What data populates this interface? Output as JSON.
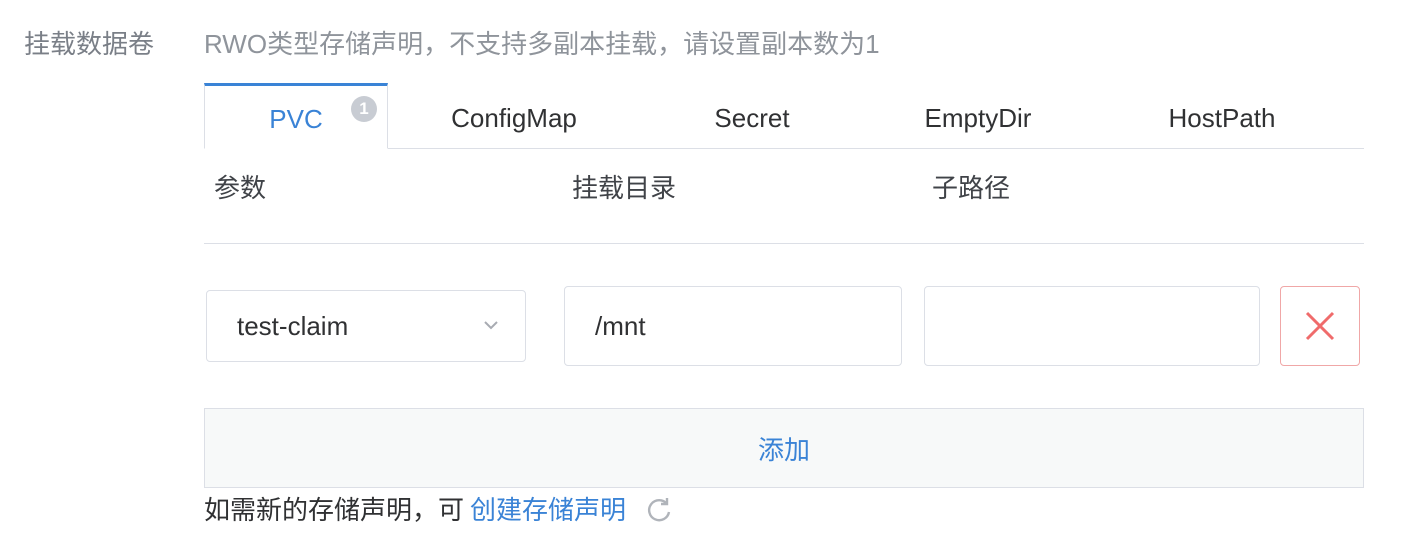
{
  "form": {
    "label": "挂载数据卷",
    "hint": "RWO类型存储声明，不支持多副本挂载，请设置副本数为1"
  },
  "tabs": [
    {
      "label": "PVC",
      "badge": "1",
      "active": true
    },
    {
      "label": "ConfigMap"
    },
    {
      "label": "Secret"
    },
    {
      "label": "EmptyDir"
    },
    {
      "label": "HostPath"
    }
  ],
  "table": {
    "headers": [
      "参数",
      "挂载目录",
      "子路径"
    ],
    "row": {
      "param_value": "test-claim",
      "mount_value": "/mnt",
      "subpath_value": ""
    }
  },
  "add_label": "添加",
  "footer": {
    "text": "如需新的存储声明，可",
    "link": "创建存储声明"
  },
  "icons": {
    "chevron": "chevron-down-icon",
    "delete": "close-icon",
    "refresh": "refresh-icon"
  },
  "colors": {
    "accent": "#3a83d6",
    "danger": "#f06b6b"
  }
}
